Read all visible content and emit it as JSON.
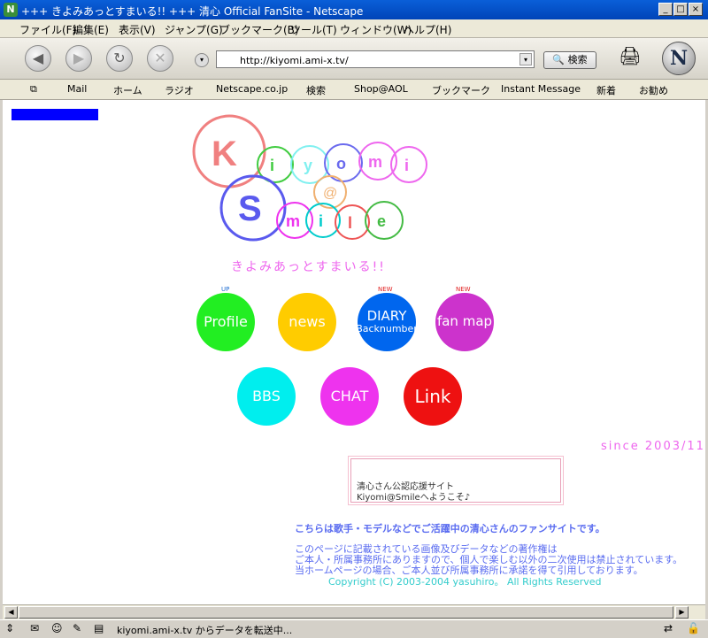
{
  "window": {
    "title": "+++ きよみあっとすまいる!! +++ 清心 Official FanSite - Netscape"
  },
  "menu": [
    "ファイル(F)",
    "編集(E)",
    "表示(V)",
    "ジャンプ(G)",
    "ブックマーク(B)",
    "ツール(T)",
    "ウィンドウ(W)",
    "ヘルプ(H)"
  ],
  "nav": {
    "url": "http://kiyomi.ami-x.tv/",
    "search_label": "検索"
  },
  "personal_toolbar": [
    "Mail",
    "ホーム",
    "ラジオ",
    "Netscape.co.jp",
    "検索",
    "Shop@AOL",
    "ブックマーク",
    "Instant Message",
    "新着",
    "お勧め"
  ],
  "site": {
    "logo_letters": [
      "K",
      "i",
      "y",
      "o",
      "m",
      "i",
      "@",
      "S",
      "m",
      "i",
      "l",
      "e"
    ],
    "tagline": "きよみあっとすまいる!!",
    "buttons": [
      {
        "label": "Profile",
        "badge": "UP",
        "color": "#22ee22"
      },
      {
        "label": "news",
        "badge": "",
        "color": "#ffcc00"
      },
      {
        "label": "DIARY",
        "sublabel": "Backnumber",
        "badge": "NEW",
        "color": "#0066ee"
      },
      {
        "label": "fan map",
        "badge": "NEW",
        "color": "#cc33cc"
      },
      {
        "label": "BBS",
        "badge": "",
        "color": "#00eeee"
      },
      {
        "label": "CHAT",
        "badge": "",
        "color": "#ee33ee"
      },
      {
        "label": "Link",
        "badge": "",
        "color": "#ee1111"
      }
    ],
    "since": "since 2003/11",
    "welcome_line1": "清心さん公認応援サイト",
    "welcome_line2": "Kiyomi@Smileへようこそ♪",
    "intro": "こちらは歌手・モデルなどでご活躍中の清心さんのファンサイトです。",
    "copyright_lines": [
      "このページに記載されている画像及びデータなどの著作権は",
      "ご本人・所属事務所にありますので、個人で楽しむ以外の二次使用は禁止されています。",
      "当ホームページの場合、ご本人並び所属事務所に承諾を得て引用しております。"
    ],
    "copyright": "Copyright (C) 2003-2004 yasuhiro。 All Rights Reserved"
  },
  "status": {
    "message": "kiyomi.ami-x.tv からデータを転送中..."
  }
}
